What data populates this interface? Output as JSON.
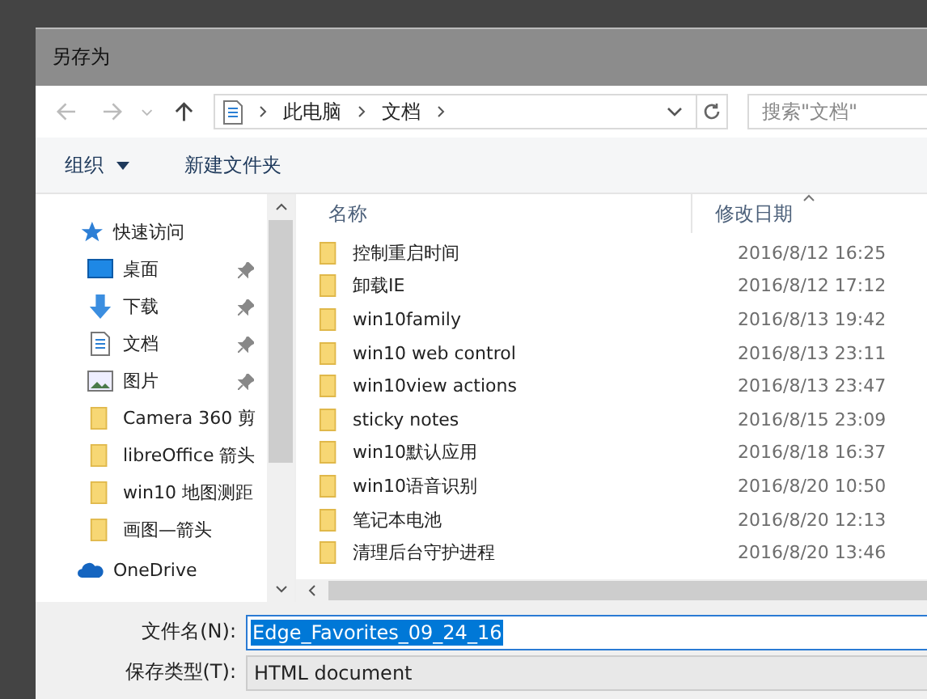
{
  "window": {
    "title": "另存为"
  },
  "nav": {
    "path": [
      "此电脑",
      "文档"
    ],
    "search_placeholder": "搜索\"文档\""
  },
  "toolbar": {
    "organize": "组织",
    "new_folder": "新建文件夹"
  },
  "sidebar": {
    "items": [
      {
        "label": "快速访问",
        "kind": "star",
        "pinned": false
      },
      {
        "label": "桌面",
        "kind": "desktop",
        "pinned": true
      },
      {
        "label": "下载",
        "kind": "download",
        "pinned": true
      },
      {
        "label": "文档",
        "kind": "document",
        "pinned": true
      },
      {
        "label": "图片",
        "kind": "pictures",
        "pinned": true
      },
      {
        "label": "Camera 360 剪",
        "kind": "folder",
        "pinned": false
      },
      {
        "label": "libreOffice 箭头",
        "kind": "folder",
        "pinned": false
      },
      {
        "label": "win10 地图测距",
        "kind": "folder",
        "pinned": false
      },
      {
        "label": "画图—箭头",
        "kind": "folder",
        "pinned": false
      },
      {
        "label": "OneDrive",
        "kind": "cloud",
        "pinned": false
      }
    ]
  },
  "table": {
    "columns": [
      "名称",
      "修改日期"
    ],
    "rows": [
      {
        "name": "控制重启时间",
        "modified": "2016/8/12 16:25"
      },
      {
        "name": "卸载IE",
        "modified": "2016/8/12 17:12"
      },
      {
        "name": "win10family",
        "modified": "2016/8/13 19:42"
      },
      {
        "name": "win10 web control",
        "modified": "2016/8/13 23:11"
      },
      {
        "name": "win10view actions",
        "modified": "2016/8/13 23:47"
      },
      {
        "name": "sticky notes",
        "modified": "2016/8/15 23:09"
      },
      {
        "name": "win10默认应用",
        "modified": "2016/8/18 16:37"
      },
      {
        "name": "win10语音识别",
        "modified": "2016/8/20 10:50"
      },
      {
        "name": "笔记本电池",
        "modified": "2016/8/20 12:13"
      },
      {
        "name": "清理后台守护进程",
        "modified": "2016/8/20 13:46"
      }
    ]
  },
  "filename": {
    "label": "文件名(N):",
    "value": "Edge_Favorites_09_24_16",
    "text_selected": true
  },
  "filetype": {
    "label": "保存类型(T):",
    "value": "HTML document"
  }
}
